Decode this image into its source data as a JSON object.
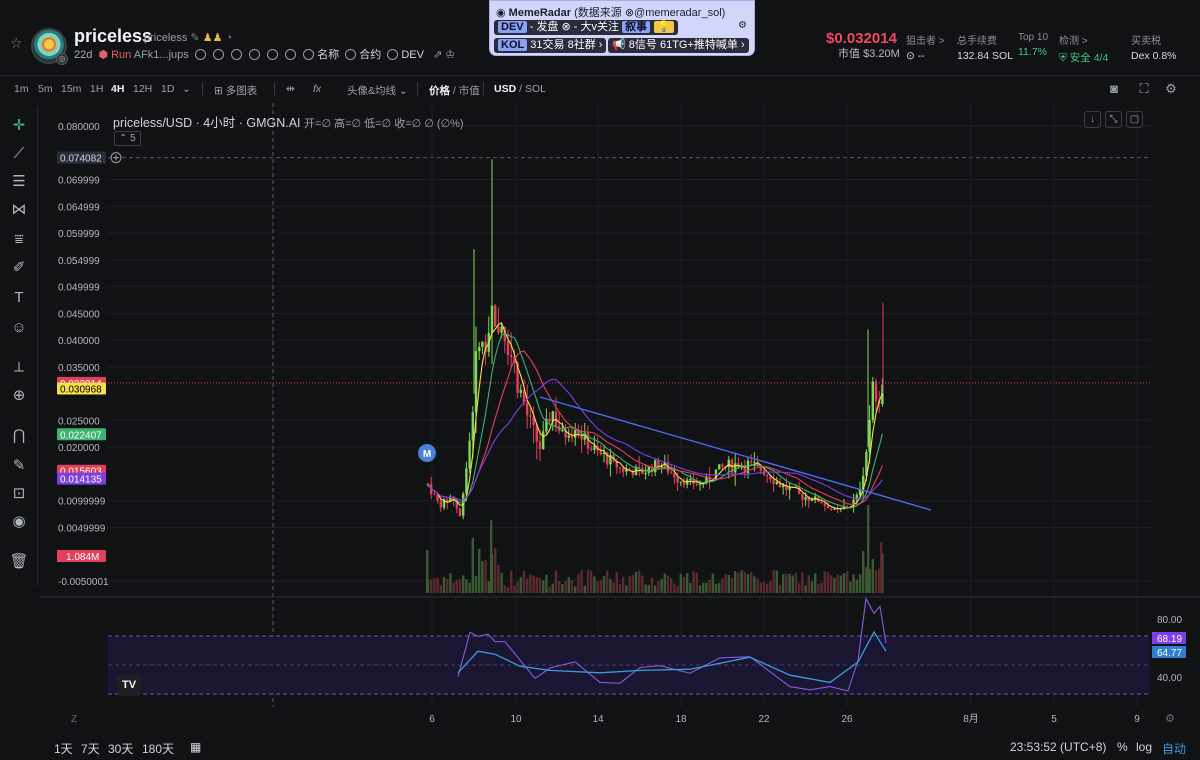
{
  "header": {
    "token_name": "priceless",
    "token_ticker": "priceless",
    "age": "22d",
    "run_label": "Run",
    "address": "AFk1...jups",
    "links": [
      "名称",
      "合约",
      "DEV"
    ],
    "price": "$0.032014",
    "mcap_label": "市值",
    "mcap_value": "$3.20M",
    "stats": [
      {
        "label": "狙击者 >",
        "value": "--"
      },
      {
        "label": "总手续费",
        "value": "132.84 SOL"
      },
      {
        "label": "Top 10",
        "value": "11.7%"
      },
      {
        "label": "检测 >",
        "value": "安全 4/4"
      },
      {
        "label": "买卖税",
        "value": "Dex 0.8%"
      }
    ]
  },
  "memeradar": {
    "title": "MemeRadar",
    "source": "(数据来源",
    "handle": "@memeradar_sol)",
    "dev_label": "DEV",
    "dev_text1": "- 发盘",
    "dev_text2": "- 大v关注",
    "narrative": "叙事",
    "kol_label": "KOL",
    "kol_trades": "31",
    "kol_trades_label": "交易",
    "kol_groups": "8",
    "kol_groups_label": "社群",
    "signals": "8",
    "signals_label": "信号",
    "tg_count": "61",
    "tg_label": "TG+推特喊单"
  },
  "toolbar": {
    "intervals": [
      "1m",
      "5m",
      "15m",
      "1H",
      "4H",
      "12H",
      "1D"
    ],
    "active_interval": "4H",
    "multi_chart": "多图表",
    "indicators": "头像&均线",
    "price_label": "价格",
    "mcap_label": "市值",
    "usd": "USD",
    "sol": "SOL"
  },
  "legend": {
    "title": "priceless/USD · 4小时 · GMGN.AI",
    "ohlc": "开=∅  高=∅  低=∅  收=∅  ∅ (∅%)",
    "ma_count": "5"
  },
  "chart_data": {
    "type": "candlestick",
    "interval": "4H",
    "x_ticks": [
      "6",
      "10",
      "14",
      "18",
      "22",
      "26",
      "8月",
      "5",
      "9"
    ],
    "y_ticks": [
      "0.080000",
      "0.074082",
      "0.069999",
      "0.064999",
      "0.059999",
      "0.054999",
      "0.049999",
      "0.045000",
      "0.040000",
      "0.035000",
      "0.032014",
      "0.030968",
      "0.025000",
      "0.022407",
      "0.020000",
      "0.015603",
      "0.014135",
      "0.0099999",
      "0.0049999",
      "-0.0050001"
    ],
    "ylim": [
      -0.0050001,
      0.08
    ],
    "price_labels": [
      {
        "value": "0.074082",
        "color": "#2a2e39",
        "text_color": "#d1d4dc"
      },
      {
        "value": "0.032014",
        "color": "#e0405a",
        "text_color": "#ffffff"
      },
      {
        "value": "0.030968",
        "color": "#f5e04a",
        "text_color": "#000000"
      },
      {
        "value": "0.022407",
        "color": "#3cb371",
        "text_color": "#ffffff"
      },
      {
        "value": "0.015603",
        "color": "#e0405a",
        "text_color": "#ffffff"
      },
      {
        "value": "0.014135",
        "color": "#7b3fe4",
        "text_color": "#ffffff"
      }
    ],
    "volume_label": "1.084M",
    "marker": "M",
    "rsi": {
      "y_ticks": [
        "80.00",
        "40.00"
      ],
      "values_shown": [
        "68.19",
        "64.77"
      ]
    },
    "grid": true,
    "trendline": true
  },
  "bottom": {
    "ranges": [
      "1天",
      "7天",
      "30天",
      "180天"
    ],
    "time": "23:53:52 (UTC+8)",
    "pct": "%",
    "log": "log",
    "auto": "自动"
  }
}
